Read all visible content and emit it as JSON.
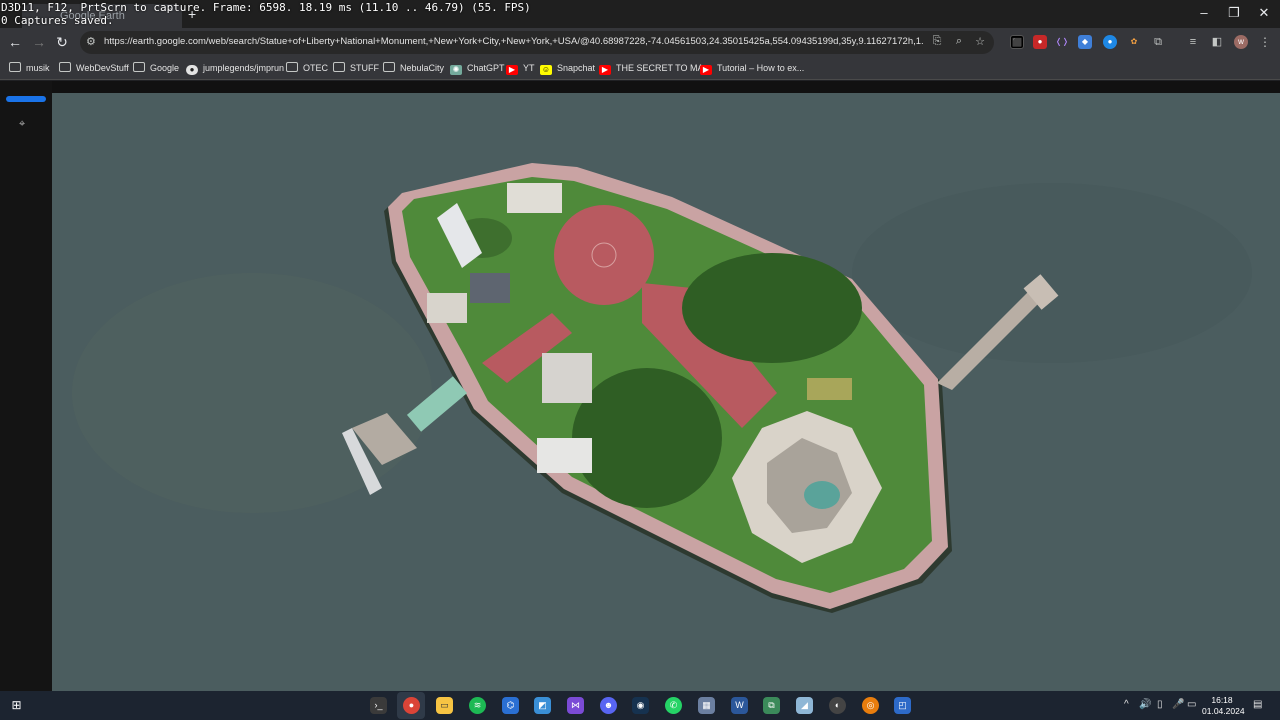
{
  "overlay": {
    "line1": "D3D11, F12, PrtScrn to capture. Frame: 6598. 18.19 ms (11.10 .. 46.79) (55. FPS)",
    "line2": "0 Captures saved."
  },
  "browser": {
    "tab_title": "Google Earth",
    "url": "https://earth.google.com/web/search/Statue+of+Liberty+National+Monument,+New+York+City,+New+York,+USA/@40.68987228,-74.04561503,24.35015425a,554.09435199d,35y,9.11627172h,1.95...",
    "bookmarks": [
      {
        "label": "musik",
        "icon": "folder-icon"
      },
      {
        "label": "WebDevStuff",
        "icon": "folder-icon"
      },
      {
        "label": "Google",
        "icon": "folder-icon"
      },
      {
        "label": "jumplegends/jmprun",
        "icon": "github-icon"
      },
      {
        "label": "OTEC",
        "icon": "folder-icon"
      },
      {
        "label": "STUFF",
        "icon": "folder-icon"
      },
      {
        "label": "NebulaCity",
        "icon": "folder-icon"
      },
      {
        "label": "ChatGPT",
        "icon": "chatgpt-icon"
      },
      {
        "label": "YT",
        "icon": "youtube-icon"
      },
      {
        "label": "Snapchat",
        "icon": "snapchat-icon"
      },
      {
        "label": "THE SECRET TO MA...",
        "icon": "youtube-icon"
      },
      {
        "label": "Tutorial – How to ex...",
        "icon": "youtube-icon"
      }
    ]
  },
  "system": {
    "time": "16:18",
    "date": "01.04.2024"
  },
  "colors": {
    "water": "#4b5d5f",
    "plaza": "#b85a60",
    "lawn": "#4f8a3a",
    "trees": "#2f5e24",
    "walkway": "#c9a3a3",
    "accent": "#1a73e8"
  }
}
